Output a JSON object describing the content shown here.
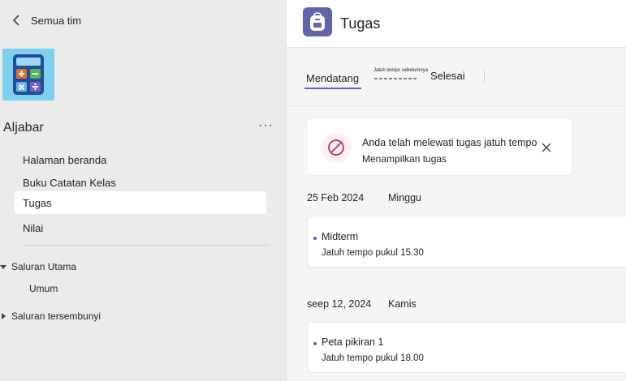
{
  "sidebar": {
    "back_label": "Semua tim",
    "team_name": "Aljabar",
    "more_label": "···",
    "items": [
      {
        "label": "Halaman beranda"
      },
      {
        "label": "Buku Catatan Kelas"
      },
      {
        "label": "Tugas",
        "selected": true
      },
      {
        "label": "Nilai"
      }
    ],
    "channels": {
      "main_group": "Saluran Utama",
      "main_items": [
        "Umum"
      ],
      "hidden_group": "Saluran tersembunyi"
    }
  },
  "header": {
    "title": "Tugas",
    "icon": "backpack-icon",
    "icon_color": "#6264a7"
  },
  "tabs": [
    {
      "label": "Mendatang",
      "active": true
    },
    {
      "label": "Jatuh tempo sebelumnya"
    },
    {
      "label": "Selesai"
    }
  ],
  "alert": {
    "title": "Anda telah melewati tugas jatuh tempo",
    "subtitle": "Menampilkan tugas"
  },
  "groups": [
    {
      "date": "25 Feb 2024",
      "day": "Minggu",
      "assignments": [
        {
          "title": "Midterm",
          "due": "Jatuh tempo pukul 15.30"
        }
      ]
    },
    {
      "date": "seep 12, 2024",
      "day": "Kamis",
      "assignments": [
        {
          "title": "Peta pikiran 1",
          "due": "Jatuh tempo pukul 18.00"
        }
      ]
    }
  ],
  "colors": {
    "accent": "#5b5fc7",
    "alert_icon": "#c4314b",
    "team_logo_bg": "#7fd0ef"
  }
}
